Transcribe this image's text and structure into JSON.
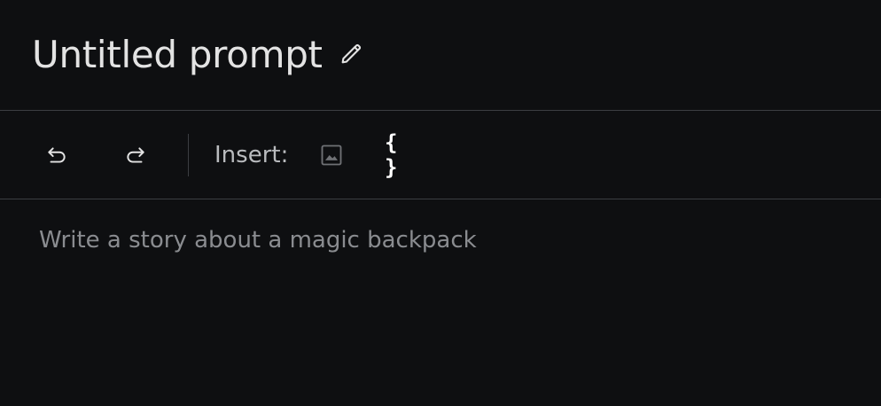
{
  "header": {
    "title": "Untitled prompt",
    "edit_icon": "pencil-icon"
  },
  "toolbar": {
    "undo_icon": "undo-icon",
    "redo_icon": "redo-icon",
    "insert_label": "Insert:",
    "image_icon": "image-icon",
    "variable_label": "{ }"
  },
  "editor": {
    "placeholder": "Write a story about a magic backpack"
  },
  "colors": {
    "background": "#0e0f11",
    "divider": "#3c3e42",
    "placeholder": "#8a8c90"
  }
}
